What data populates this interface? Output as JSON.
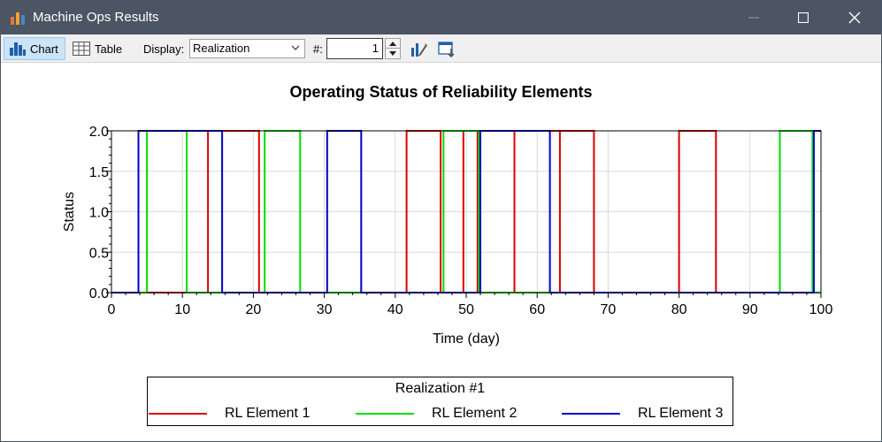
{
  "window": {
    "title": "Machine Ops Results"
  },
  "toolbar": {
    "chart_label": "Chart",
    "table_label": "Table",
    "display_label": "Display:",
    "display_value": "Realization",
    "hash_label": "#:",
    "realization_number": "1"
  },
  "chart_data": {
    "type": "line",
    "title": "Operating Status of Reliability Elements",
    "xlabel": "Time (day)",
    "ylabel": "Status",
    "xlim": [
      0,
      100
    ],
    "ylim": [
      0,
      2
    ],
    "xticks": [
      0,
      10,
      20,
      30,
      40,
      50,
      60,
      70,
      80,
      90,
      100
    ],
    "yticks": [
      "0.0",
      "0.5",
      "1.0",
      "1.5",
      "2.0"
    ],
    "grid": true,
    "legend_title": "Realization #1",
    "legend_position": "bottom",
    "series": [
      {
        "name": "RL Element 1",
        "color": "#dd0000",
        "points": [
          [
            0,
            0
          ],
          [
            13.6,
            0
          ],
          [
            13.6,
            2
          ],
          [
            20.8,
            2
          ],
          [
            20.8,
            0
          ],
          [
            41.6,
            0
          ],
          [
            41.6,
            2
          ],
          [
            46.4,
            2
          ],
          [
            46.4,
            0
          ],
          [
            49.6,
            0
          ],
          [
            49.6,
            2
          ],
          [
            51.6,
            2
          ],
          [
            51.6,
            0
          ],
          [
            56.8,
            0
          ],
          [
            56.8,
            2
          ],
          [
            63.2,
            2
          ],
          [
            63.2,
            0
          ],
          [
            63.2,
            2
          ],
          [
            68.0,
            2
          ],
          [
            68.0,
            0
          ],
          [
            80.0,
            0
          ],
          [
            80.0,
            2
          ],
          [
            85.2,
            2
          ],
          [
            85.2,
            0
          ],
          [
            100,
            0
          ]
        ]
      },
      {
        "name": "RL Element 2",
        "color": "#00dd00",
        "points": [
          [
            0,
            0
          ],
          [
            5.0,
            0
          ],
          [
            5.0,
            2
          ],
          [
            10.6,
            2
          ],
          [
            10.6,
            0
          ],
          [
            21.6,
            0
          ],
          [
            21.6,
            2
          ],
          [
            26.6,
            2
          ],
          [
            26.6,
            0
          ],
          [
            46.8,
            0
          ],
          [
            46.8,
            2
          ],
          [
            51.8,
            2
          ],
          [
            51.8,
            0
          ],
          [
            94.2,
            0
          ],
          [
            94.2,
            2
          ],
          [
            98.8,
            2
          ],
          [
            98.8,
            0
          ],
          [
            100,
            0
          ]
        ]
      },
      {
        "name": "RL Element 3",
        "color": "#0000cc",
        "points": [
          [
            0,
            0
          ],
          [
            3.8,
            0
          ],
          [
            3.8,
            2
          ],
          [
            15.6,
            2
          ],
          [
            15.6,
            0
          ],
          [
            30.4,
            0
          ],
          [
            30.4,
            2
          ],
          [
            35.2,
            2
          ],
          [
            35.2,
            0
          ],
          [
            52.0,
            0
          ],
          [
            52.0,
            2
          ],
          [
            61.8,
            2
          ],
          [
            61.8,
            0
          ],
          [
            99.0,
            0
          ],
          [
            99.0,
            2
          ],
          [
            100,
            2
          ]
        ]
      }
    ]
  }
}
